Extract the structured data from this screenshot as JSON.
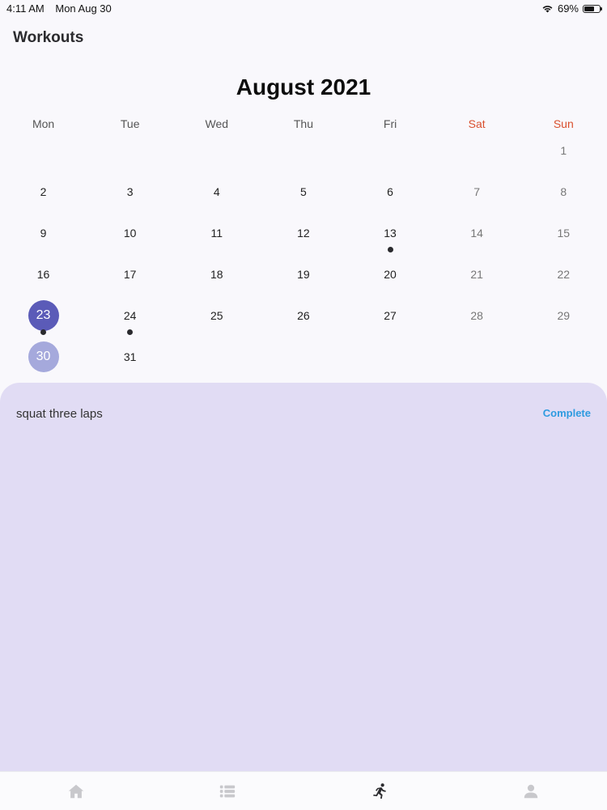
{
  "status_bar": {
    "time": "4:11 AM",
    "date": "Mon Aug 30",
    "battery_text": "69%",
    "battery_level": 0.69
  },
  "nav": {
    "title": "Workouts"
  },
  "calendar": {
    "month_title": "August 2021",
    "weekdays": [
      "Mon",
      "Tue",
      "Wed",
      "Thu",
      "Fri",
      "Sat",
      "Sun"
    ],
    "weekend_color": "#d9502e",
    "selected_color": "#5b5bb8",
    "today_color": "#a5a9dc",
    "weeks": [
      [
        null,
        null,
        null,
        null,
        null,
        null,
        "1"
      ],
      [
        "2",
        "3",
        "4",
        "5",
        "6",
        "7",
        "8"
      ],
      [
        "9",
        "10",
        "11",
        "12",
        "13",
        "14",
        "15"
      ],
      [
        "16",
        "17",
        "18",
        "19",
        "20",
        "21",
        "22"
      ],
      [
        "23",
        "24",
        "25",
        "26",
        "27",
        "28",
        "29"
      ],
      [
        "30",
        "31",
        null,
        null,
        null,
        null,
        null
      ]
    ],
    "selected_day": "23",
    "today": "30",
    "days_with_workouts": [
      "13",
      "23",
      "24"
    ]
  },
  "sheet": {
    "task_text": "squat three laps",
    "action_label": "Complete",
    "background": "#e1dcf4",
    "action_color": "#2e9be0"
  },
  "tab_bar": {
    "tabs": [
      {
        "icon": "home-icon",
        "active": false
      },
      {
        "icon": "list-icon",
        "active": false
      },
      {
        "icon": "running-icon",
        "active": true
      },
      {
        "icon": "person-icon",
        "active": false
      }
    ]
  }
}
